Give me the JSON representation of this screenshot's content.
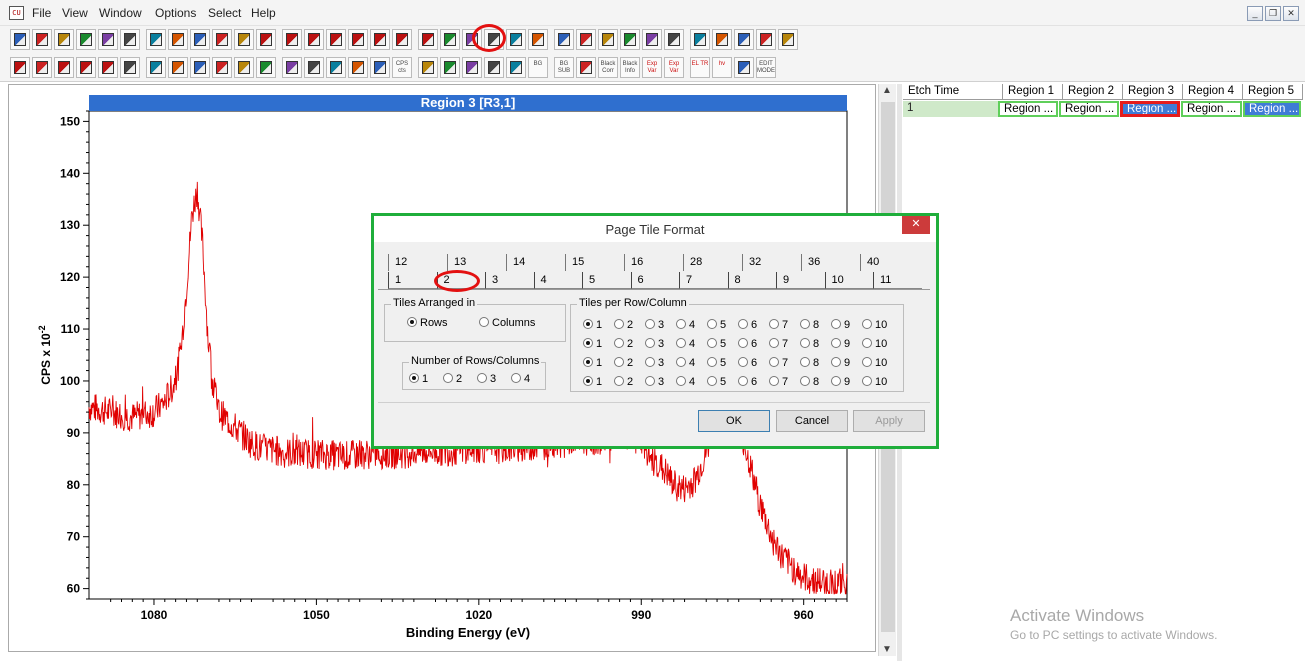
{
  "menu": {
    "app_icon": "app-icon",
    "items": [
      "File",
      "View",
      "Window",
      "Options",
      "Select",
      "Help"
    ],
    "window_controls": [
      "_",
      "❐",
      "✕"
    ]
  },
  "plot": {
    "title": "Region 3 [R3,1]",
    "xlabel": "Binding Energy (eV)",
    "ylabel": "CPS x 10",
    "ylabel_sup": "-2"
  },
  "chart_data": {
    "type": "line",
    "title": "Region 3 [R3,1]",
    "xlabel": "Binding Energy (eV)",
    "ylabel": "CPS x 10-2",
    "x_reversed": true,
    "xlim": [
      1092,
      952
    ],
    "ylim": [
      58,
      152
    ],
    "xticks": [
      1080,
      1050,
      1020,
      990,
      960
    ],
    "yticks": [
      60,
      70,
      80,
      90,
      100,
      110,
      120,
      130,
      140,
      150
    ],
    "series": [
      {
        "color": "#e00000",
        "x": [
          1092,
          1088,
          1084,
          1080,
          1078,
          1076,
          1075,
          1074,
          1073,
          1072,
          1071,
          1070,
          1069,
          1068,
          1066,
          1064,
          1062,
          1060,
          1057,
          1054,
          1050,
          1045,
          1040,
          1035,
          1030,
          1025,
          1020,
          1015,
          1010,
          1005,
          1000,
          995,
          992,
          990,
          988,
          986,
          984,
          982,
          980,
          978,
          976,
          974,
          972,
          970,
          968,
          966,
          964,
          962,
          960,
          956,
          952
        ],
        "y": [
          95,
          94,
          93,
          94,
          96,
          100,
          106,
          118,
          132,
          137,
          126,
          108,
          99,
          94,
          92,
          90,
          88,
          87,
          86.5,
          86,
          86,
          85.5,
          86,
          86,
          86.5,
          86.5,
          87,
          87,
          87.5,
          88,
          88.5,
          89,
          89.5,
          88,
          85,
          83,
          80,
          79,
          81,
          86,
          93,
          97,
          92,
          84,
          76,
          70,
          66,
          64,
          62,
          61,
          61
        ]
      }
    ]
  },
  "grid": {
    "headers": [
      "Etch Time",
      "Region 1",
      "Region 2",
      "Region 3",
      "Region 4",
      "Region 5"
    ],
    "row": [
      "1",
      "Region ...",
      "Region ...",
      "Region ...",
      "Region ...",
      "Region ..."
    ]
  },
  "activate": {
    "title": "Activate Windows",
    "subtitle": "Go to PC settings to activate Windows."
  },
  "dialog": {
    "title": "Page Tile Format",
    "close": "✕",
    "tabs_back": [
      "12",
      "13",
      "14",
      "15",
      "16",
      "28",
      "32",
      "36",
      "40"
    ],
    "tabs_front": [
      "1",
      "2",
      "3",
      "4",
      "5",
      "6",
      "7",
      "8",
      "9",
      "10",
      "11"
    ],
    "active_tab": "2",
    "arranged": {
      "label": "Tiles Arranged in",
      "options": [
        "Rows",
        "Columns"
      ],
      "selected": "Rows"
    },
    "number": {
      "label": "Number of Rows/Columns",
      "options": [
        "1",
        "2",
        "3",
        "4"
      ],
      "selected": "1"
    },
    "tiles_per": {
      "label": "Tiles per Row/Column",
      "options": [
        "1",
        "2",
        "3",
        "4",
        "5",
        "6",
        "7",
        "8",
        "9",
        "10"
      ],
      "rows_selected": [
        "1",
        "1",
        "1",
        "1"
      ]
    },
    "buttons": {
      "ok": "OK",
      "cancel": "Cancel",
      "apply": "Apply"
    }
  },
  "toolbar_icons": {
    "row1": [
      "new",
      "open",
      "open-folder",
      "save",
      "save-as",
      "copy",
      "copy-2",
      "copy-3",
      "copy-4",
      "page",
      "page-2",
      "save-red",
      "save-red-2",
      "save-red-3",
      "save-red-4",
      "save-red-5",
      "save-red-6",
      "save-red-7",
      "save-red-8",
      "notes",
      "clipboard",
      "page-tile",
      "tile-view",
      "spectrum",
      "arrow-right",
      "pencil",
      "dataset",
      "print-setup",
      "insert",
      "export",
      "briefcase",
      "tray",
      "print",
      "preview",
      "help"
    ],
    "row2": [
      "select-all",
      "copy-view",
      "red-tiles",
      "color-bar",
      "frame",
      "window",
      "shift-right",
      "shift-left",
      "shift-inward",
      "peak-up",
      "peak-down",
      "both-ways",
      "triangle",
      "caret-up",
      "caret-down",
      "marker",
      "regress",
      "cps-mode",
      "curve-fit",
      "graph",
      "bar",
      "chart-box",
      "chart-line",
      "bg",
      "bg-sub",
      "peak-fit",
      "black-corr",
      "black-info",
      "exp-var",
      "exp-var-2",
      "el-tr",
      "hv",
      "energy",
      "edit-modes"
    ],
    "row2_text": {
      "black-corr": "Black Corr",
      "black-info": "Black Info",
      "exp-var": "Exp Var",
      "exp-var-2": "Exp Var",
      "el-tr": "EL TR",
      "hv": "hv",
      "edit-modes": "EDIT MODE",
      "bg": "BG",
      "bg-sub": "BG SUB",
      "cps-mode": "CPS cts"
    }
  }
}
